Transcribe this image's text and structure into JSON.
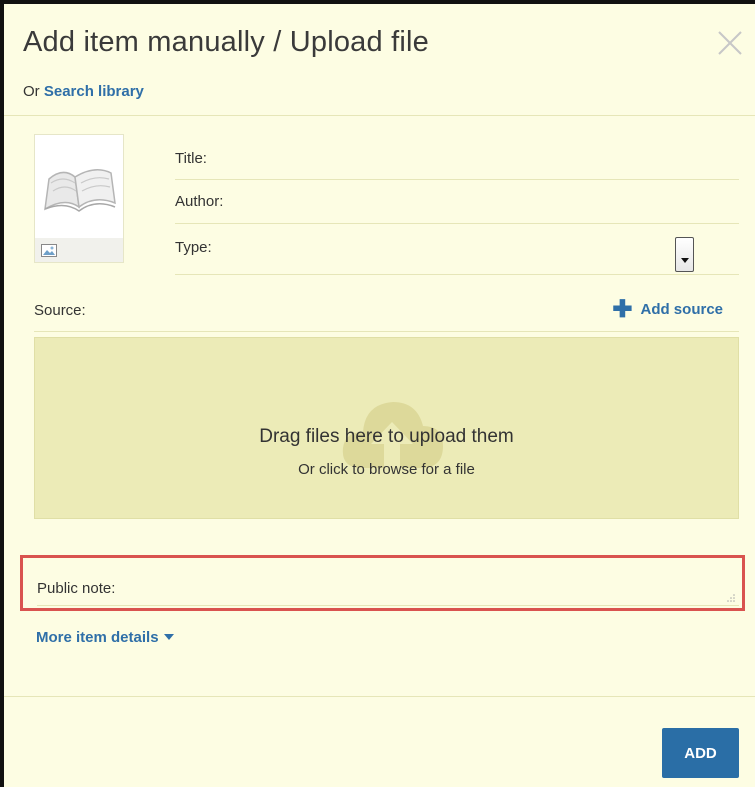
{
  "dialog": {
    "title": "Add item manually / Upload file",
    "subline_prefix": "Or",
    "search_link": "Search library"
  },
  "form": {
    "title_label": "Title:",
    "author_label": "Author:",
    "type_label": "Type:",
    "source_label": "Source:",
    "add_source_label": "Add source"
  },
  "dropzone": {
    "title": "Drag files here to upload them",
    "subtitle": "Or click to browse for a file"
  },
  "note": {
    "label": "Public note:"
  },
  "more_details_label": "More item details",
  "footer": {
    "add_button": "ADD"
  },
  "colors": {
    "background": "#fdfde3",
    "link": "#2f6fa8",
    "dropzone": "#ecebb7",
    "highlight": "#d9534f",
    "primary_button": "#2a6ea6"
  },
  "icons": {
    "close": "close-icon",
    "book": "book-icon",
    "image": "image-icon",
    "plus": "plus-icon",
    "cloud_upload": "cloud-upload-icon",
    "caret": "caret-down-icon"
  }
}
